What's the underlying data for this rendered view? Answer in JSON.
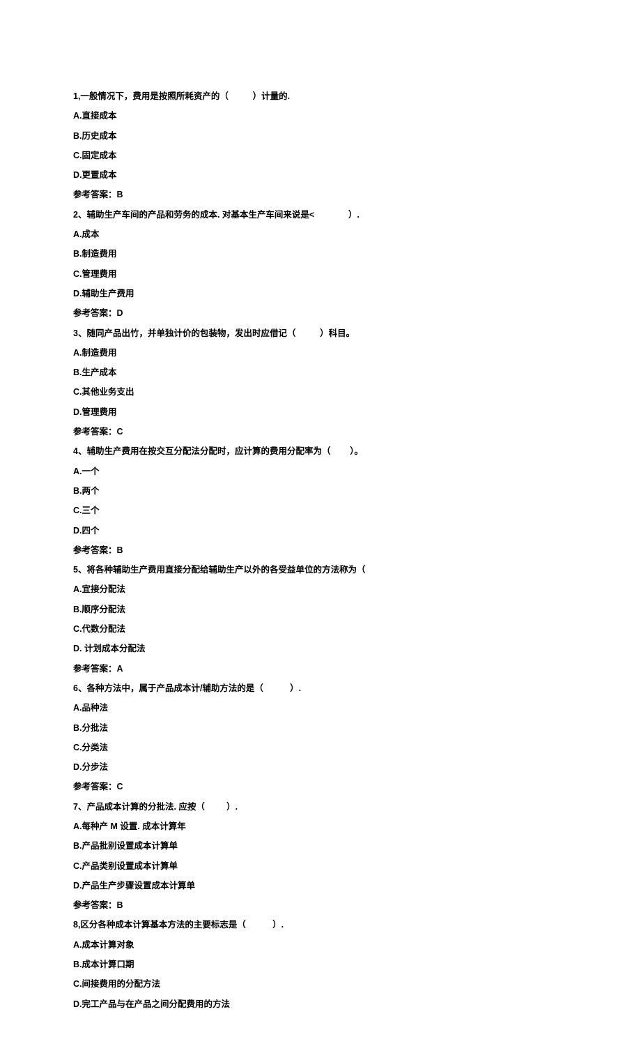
{
  "questions": [
    {
      "num": "1",
      "stem_pre": ",一般情况下，费用是按照所耗资产的（          ）计量的.",
      "opts": [
        "A.直接成本",
        "B.历史成本",
        "C.固定成本",
        "D.更置成本"
      ],
      "ans": "参考答案：B"
    },
    {
      "num": "2",
      "stem_pre": "、辅助生产车间的产品和劳务的成本. 对基本生产车间来说是<              ）.",
      "opts": [
        "A.成本",
        "B.制造费用",
        "C.管理费用",
        "D.辅助生产费用"
      ],
      "ans": "参考答案：D"
    },
    {
      "num": "3",
      "stem_pre": "、随同产品出竹，并单独计价的包装物，发出时应借记（          ）科目。",
      "opts": [
        "A.制造费用",
        "B.生产成本",
        "C.其他业务支出",
        "D.管理费用"
      ],
      "ans": "参考答案：C"
    },
    {
      "num": "4",
      "stem_pre": "、辅助生产费用在按交互分配法分配时，应计算的费用分配率为（        ）。",
      "opts": [
        "A.一个",
        "B.两个",
        "C.三个",
        "D.四个"
      ],
      "ans": "参考答案：B"
    },
    {
      "num": "5",
      "stem_pre": "、将各种辅助生产费用直接分配给辅助生产以外的各受益单位的方法称为（",
      "opts": [
        "A.宜接分配法",
        "B.顺序分配法",
        "C.代数分配法",
        "D. 计划成本分配法"
      ],
      "ans": "参考答案：A"
    },
    {
      "num": "6",
      "stem_pre": "、各种方法中，属于产品成本计/辅助方法的是（           ）.",
      "opts": [
        "A.品种法",
        "B.分批法",
        "C.分类法",
        "D.分步法"
      ],
      "ans": "参考答案：C"
    },
    {
      "num": "7",
      "stem_pre": "、产品成本计算的分批法. 应按（         ）.",
      "opts": [
        "A.每种产 M 设置. 成本计算年",
        "B.产品批别设置成本计算单",
        "C.产品类别设置成本计算单",
        "D.产品生产步骤设置成本计算单"
      ],
      "ans": "参考答案：B"
    },
    {
      "num": "8",
      "stem_pre": ",区分各种成本计算基本方法的主要标志是（           ）.",
      "opts": [
        "A.成本计算对象",
        "B.成本计算口期",
        "C.间接费用的分配方法",
        "D.完工产品与在产品之间分配费用的方法"
      ],
      "ans": null
    }
  ]
}
